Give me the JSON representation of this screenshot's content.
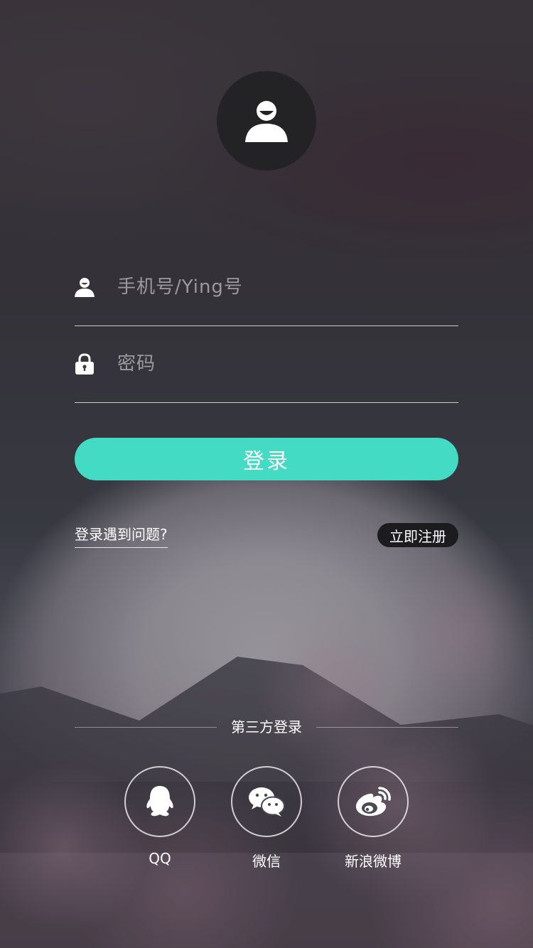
{
  "login": {
    "username_placeholder": "手机号/Ying号",
    "password_placeholder": "密码",
    "submit_label": "登录",
    "trouble_link": "登录遇到问题?",
    "register_label": "立即注册"
  },
  "third_party": {
    "title": "第三方登录",
    "providers": [
      {
        "label": "QQ",
        "icon": "qq-penguin-icon"
      },
      {
        "label": "微信",
        "icon": "wechat-icon"
      },
      {
        "label": "新浪微博",
        "icon": "weibo-icon"
      }
    ]
  },
  "colors": {
    "accent": "#43dbc3",
    "avatar_bg": "#232325",
    "register_bg": "#1c1c1e"
  }
}
